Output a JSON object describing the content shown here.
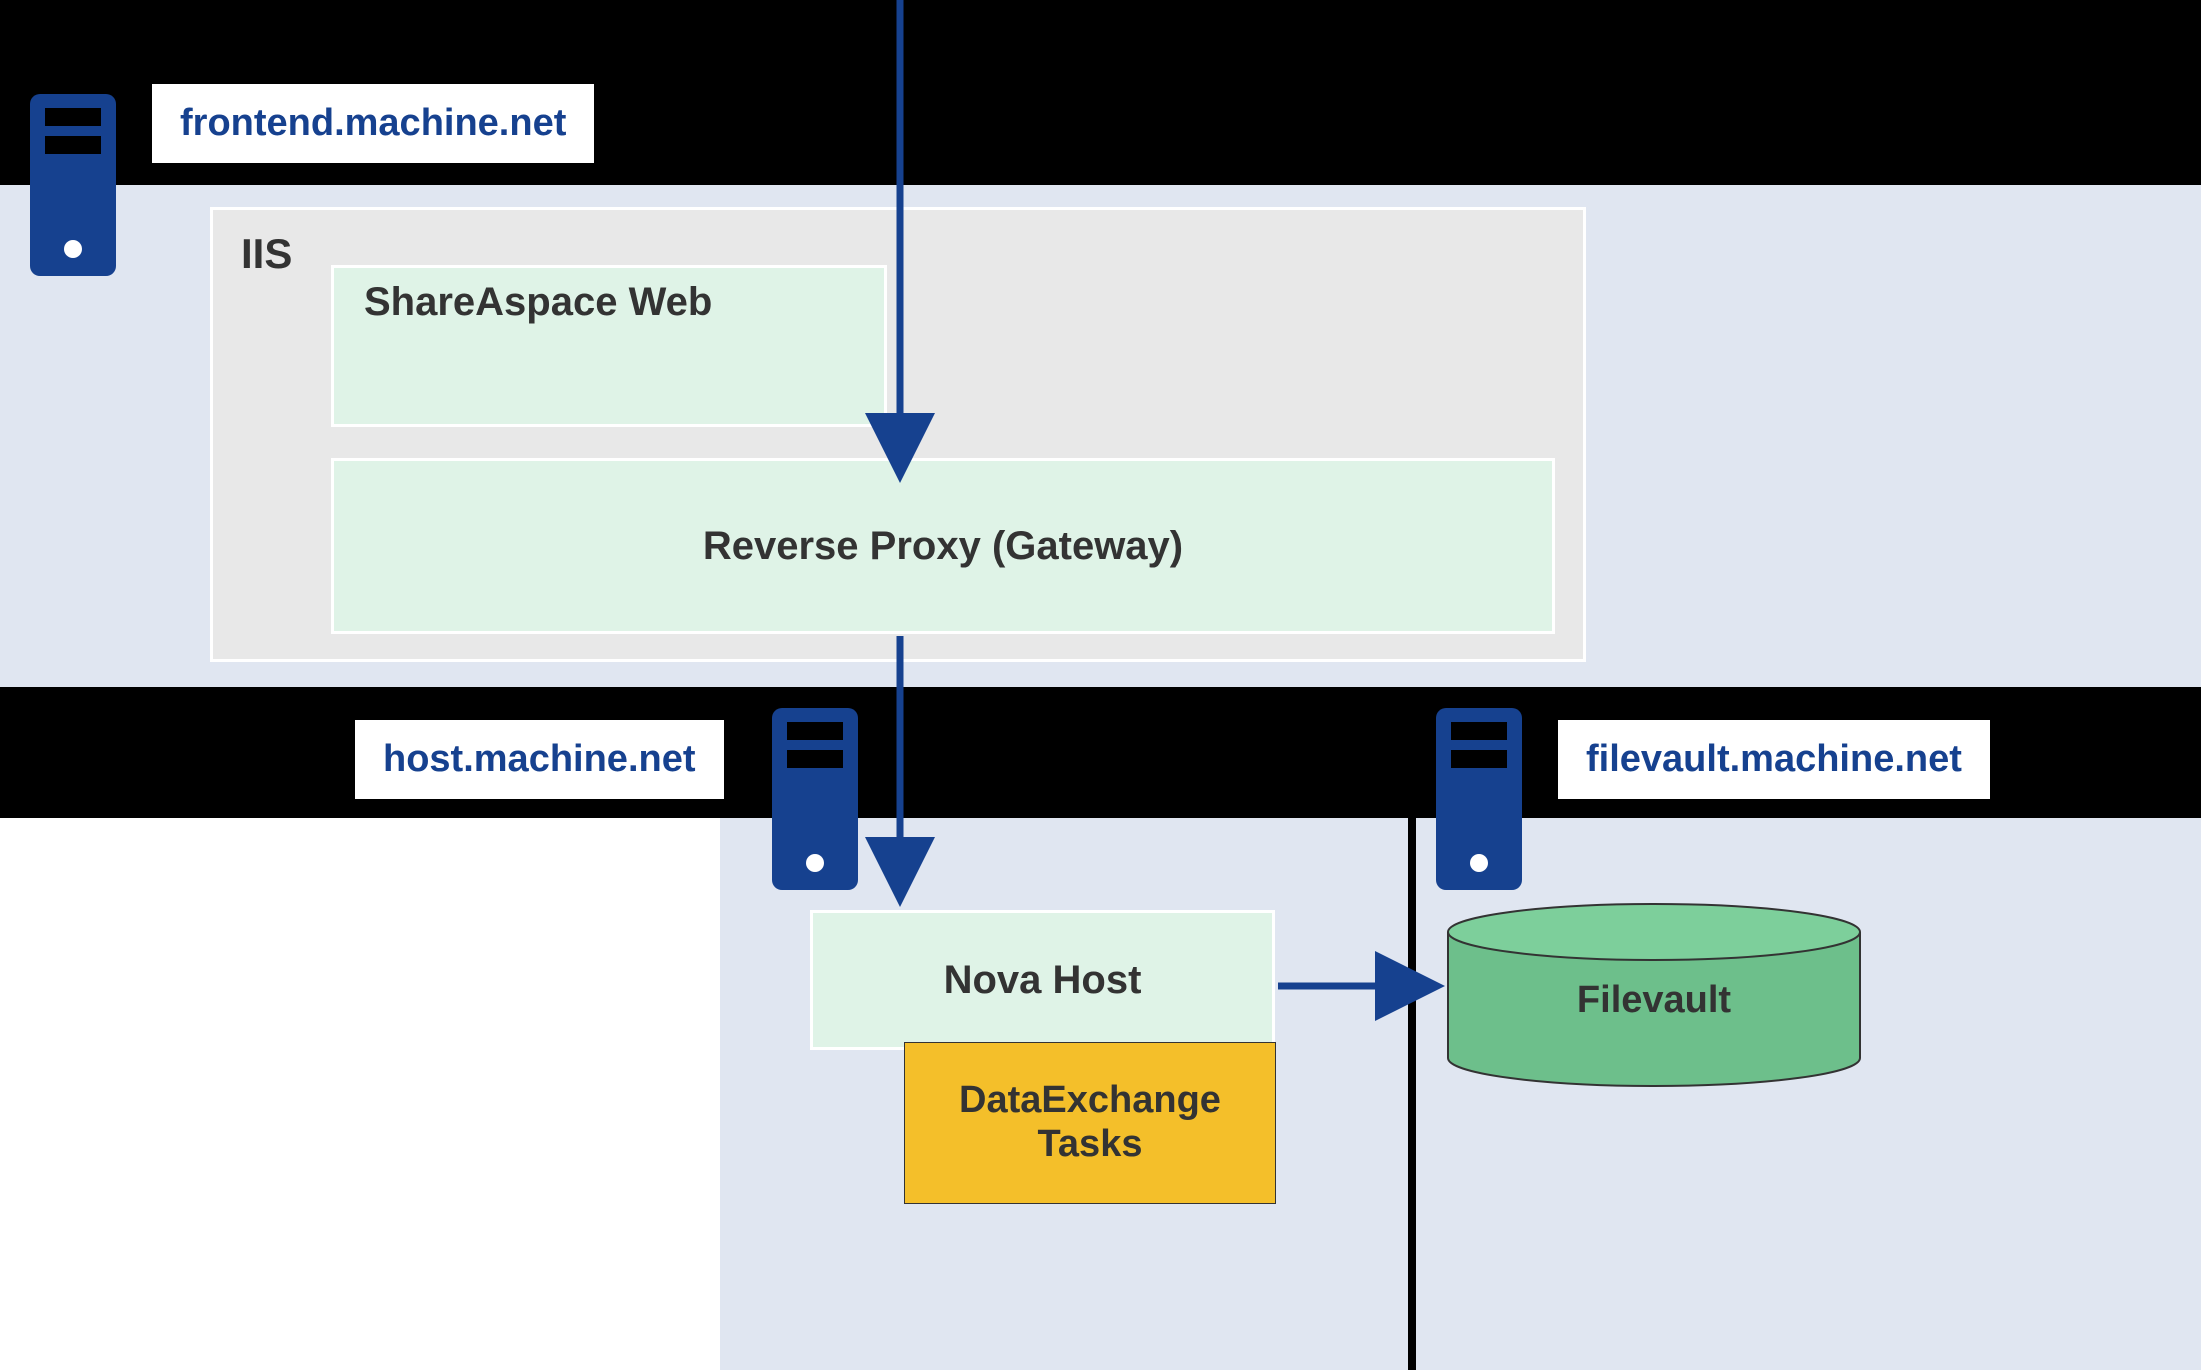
{
  "machines": {
    "frontend": {
      "label": "frontend.machine.net"
    },
    "host": {
      "label": "host.machine.net"
    },
    "filevault": {
      "label": "filevault.machine.net"
    }
  },
  "iis": {
    "label": "IIS",
    "shareaspace": "ShareAspace Web",
    "reverseProxy": "Reverse Proxy (Gateway)"
  },
  "host_components": {
    "novaHost": "Nova Host",
    "dataExchange": "DataExchange Tasks"
  },
  "filevault_components": {
    "filevault": "Filevault"
  },
  "colors": {
    "serverBlue": "#16418F",
    "lightBlueBg": "#E0E6F1",
    "greenBox": "#DFF3E7",
    "cylinderGreen": "#6DBF8B",
    "cylinderTop": "#7DCF9B",
    "yellow": "#F4BF2A",
    "iisGrey": "#E8E8E8"
  }
}
